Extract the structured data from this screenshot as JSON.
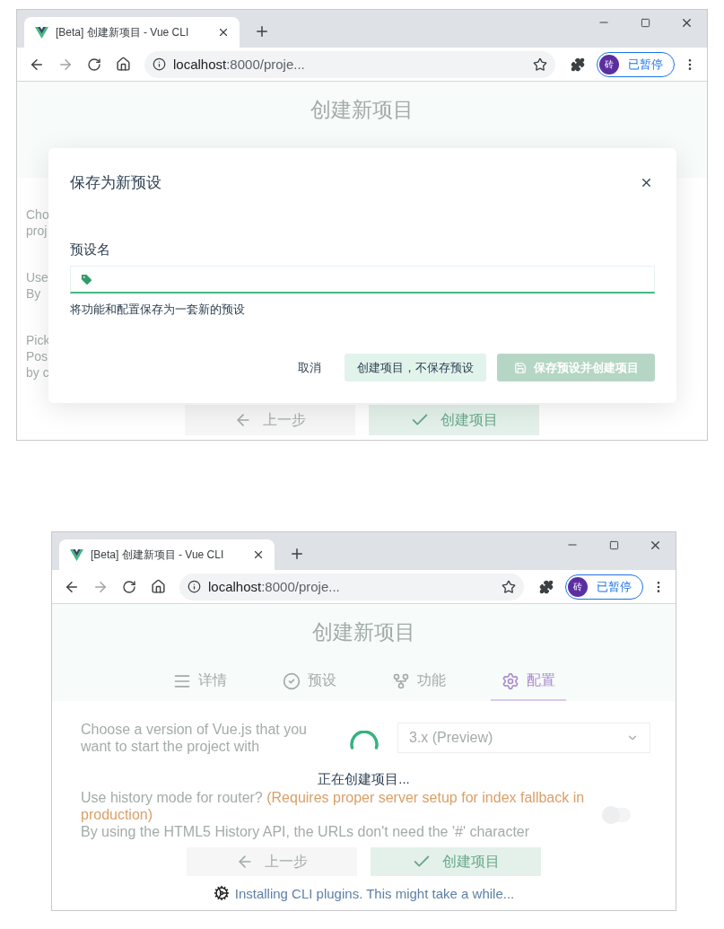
{
  "windows": [
    {
      "kind": "modal",
      "tab": {
        "title": "[Beta] 创建新项目 - Vue CLI"
      },
      "address": {
        "host": "localhost",
        "path": ":8000/proje..."
      },
      "profile": {
        "initial": "砖",
        "status": "已暂停"
      },
      "page": {
        "title": "创建新项目",
        "rows": [
          {
            "kind": "cut",
            "lines": [
              "Cho",
              "proj"
            ]
          },
          {
            "kind": "cut",
            "lines": [
              "Use",
              "By"
            ]
          },
          {
            "kind": "cut",
            "lines": [
              "Pick",
              "Pos",
              "by c"
            ]
          }
        ],
        "buttons": [
          {
            "kind": "back",
            "label": "上一步"
          },
          {
            "kind": "create",
            "label": "创建项目"
          }
        ]
      },
      "dialog": {
        "title": "保存为新预设",
        "field_label": "预设名",
        "hint": "将功能和配置保存为一套新的预设",
        "buttons": [
          {
            "kind": "text",
            "label": "取消",
            "disabled": false
          },
          {
            "kind": "light",
            "label": "创建项目，不保存预设",
            "disabled": false
          },
          {
            "kind": "save",
            "label": "保存预设并创建项目",
            "disabled": true
          }
        ]
      }
    },
    {
      "kind": "loading",
      "tab": {
        "title": "[Beta] 创建新项目 - Vue CLI"
      },
      "address": {
        "host": "localhost",
        "path": ":8000/proje..."
      },
      "profile": {
        "initial": "砖",
        "status": "已暂停"
      },
      "page": {
        "title": "创建新项目",
        "steps": [
          {
            "label": "详情",
            "selected": false
          },
          {
            "label": "预设",
            "selected": false
          },
          {
            "label": "功能",
            "selected": false
          },
          {
            "label": "配置",
            "selected": true
          }
        ],
        "rows": [
          {
            "kind": "select",
            "question": "Choose a version of Vue.js that you want to start the project with",
            "value": "3.x (Preview)"
          },
          {
            "kind": "toggle",
            "question": "Use history mode for router?",
            "note": "(Requires proper server setup for index fallback in production)",
            "description": "By using the HTML5 History API, the URLs don't need the '#' character",
            "on": false
          }
        ],
        "buttons": [
          {
            "kind": "back",
            "label": "上一步"
          },
          {
            "kind": "create",
            "label": "创建项目"
          }
        ]
      },
      "loading": {
        "message": "正在创建项目...",
        "status": "Installing CLI plugins. This might take a while..."
      }
    }
  ]
}
